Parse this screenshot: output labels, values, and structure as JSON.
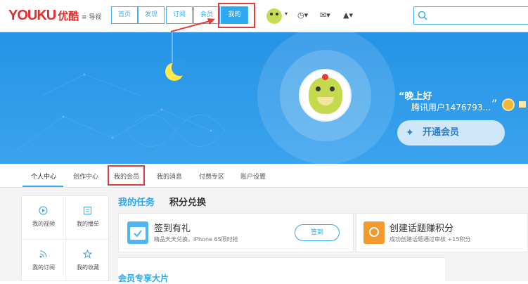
{
  "header": {
    "logo_text": "YOUKU",
    "logo_cn": "优酷",
    "guide_label": "导视",
    "nav": [
      {
        "label": "首页"
      },
      {
        "label": "发现"
      },
      {
        "label": "订阅"
      },
      {
        "label": "会员"
      },
      {
        "label": "我的"
      }
    ],
    "search_placeholder": ""
  },
  "banner": {
    "greeting": "晚上好",
    "username": "腾讯用户1476793...",
    "open_vip_label": "开通会员"
  },
  "tabs": [
    {
      "label": "个人中心"
    },
    {
      "label": "创作中心"
    },
    {
      "label": "我的会员"
    },
    {
      "label": "我的消息"
    },
    {
      "label": "付费专区"
    },
    {
      "label": "账户设置"
    }
  ],
  "sidebar": {
    "items": [
      {
        "label": "我的视频",
        "icon": "play-icon"
      },
      {
        "label": "我的播单",
        "icon": "playlist-icon"
      },
      {
        "label": "我的订阅",
        "icon": "rss-icon"
      },
      {
        "label": "我的收藏",
        "icon": "star-icon"
      }
    ]
  },
  "main": {
    "tab_tasks": "我的任务",
    "tab_exchange": "积分兑换",
    "checkin": {
      "title": "签到有礼",
      "desc": "精品天天兑换，iPhone 6S限时抢",
      "button": "签到"
    },
    "topic": {
      "title": "创建话题赚积分",
      "desc": "成功创建话题通过审核 +15积分"
    },
    "vip_section_title": "会员专享大片"
  },
  "colors": {
    "accent": "#2fa8ee",
    "banner": "#2593e6",
    "annotation_red": "#e33b3b",
    "logo_red": "#e32d2d"
  }
}
